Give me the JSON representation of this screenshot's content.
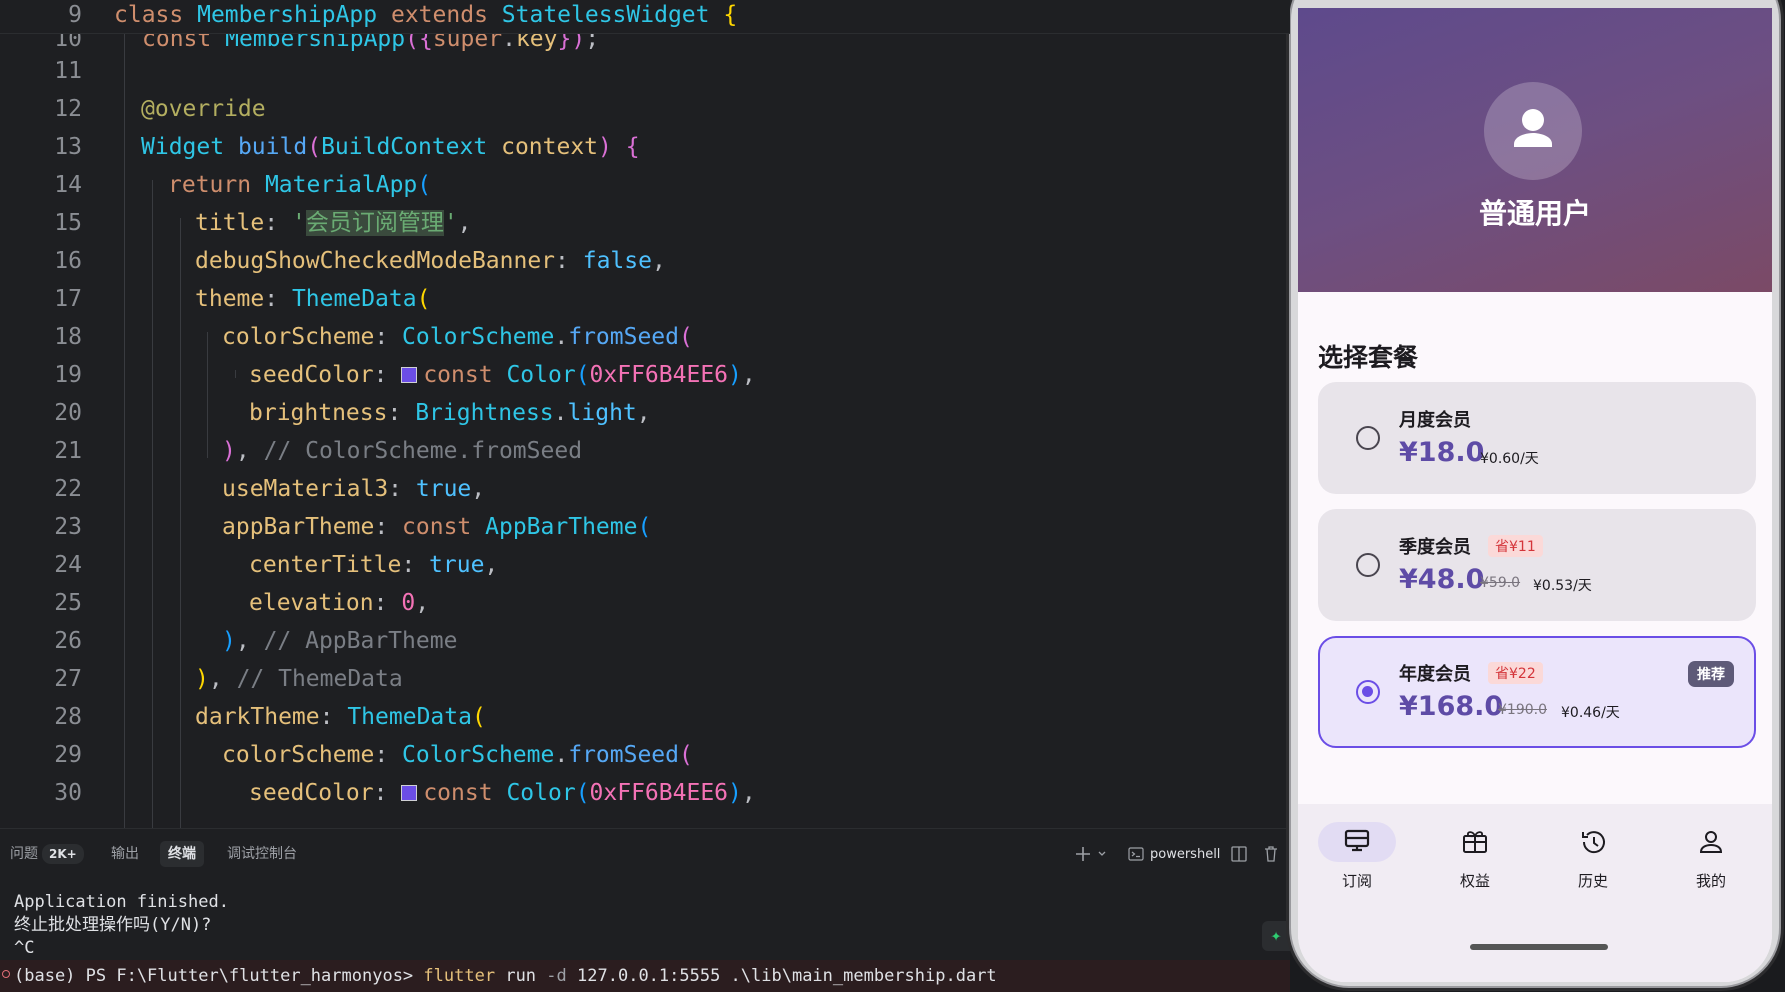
{
  "editor": {
    "sticky": {
      "line": "9",
      "text": "class MembershipApp extends StatelessWidget {"
    },
    "lines": [
      {
        "n": "10",
        "text": "const MembershipApp({super.key});"
      },
      {
        "n": "11",
        "text": ""
      },
      {
        "n": "12",
        "text": "@override"
      },
      {
        "n": "13",
        "text": "Widget build(BuildContext context) {"
      },
      {
        "n": "14",
        "text": "return MaterialApp("
      },
      {
        "n": "15",
        "text": "title: '会员订阅管理',"
      },
      {
        "n": "16",
        "text": "debugShowCheckedModeBanner: false,"
      },
      {
        "n": "17",
        "text": "theme: ThemeData("
      },
      {
        "n": "18",
        "text": "colorScheme: ColorScheme.fromSeed("
      },
      {
        "n": "19",
        "text": "seedColor: const Color(0xFF6B4EE6),"
      },
      {
        "n": "20",
        "text": "brightness: Brightness.light,"
      },
      {
        "n": "21",
        "text": "), // ColorScheme.fromSeed"
      },
      {
        "n": "22",
        "text": "useMaterial3: true,"
      },
      {
        "n": "23",
        "text": "appBarTheme: const AppBarTheme("
      },
      {
        "n": "24",
        "text": "centerTitle: true,"
      },
      {
        "n": "25",
        "text": "elevation: 0,"
      },
      {
        "n": "26",
        "text": "), // AppBarTheme"
      },
      {
        "n": "27",
        "text": "), // ThemeData"
      },
      {
        "n": "28",
        "text": "darkTheme: ThemeData("
      },
      {
        "n": "29",
        "text": "colorScheme: ColorScheme.fromSeed("
      },
      {
        "n": "30",
        "text": "seedColor: const Color(0xFF6B4EE6),"
      }
    ],
    "swatch_color": "#6B4EE6"
  },
  "panel": {
    "tabs": [
      {
        "label": "问题",
        "badge": "2K+"
      },
      {
        "label": "输出"
      },
      {
        "label": "终端"
      },
      {
        "label": "调试控制台"
      }
    ],
    "active_tab": "终端",
    "shell_label": "powershell",
    "terminal_lines": [
      "Application finished.",
      "终止批处理操作吗(Y/N)?",
      "^C"
    ],
    "command": {
      "prompt": "(base) PS F:\\Flutter\\flutter_harmonyos>",
      "program": "flutter",
      "args1": "run",
      "flag": "-d",
      "args2": "127.0.0.1:5555 .\\lib\\main_membership.dart"
    }
  },
  "app": {
    "username": "普通用户",
    "section_title": "选择套餐",
    "plans": [
      {
        "name": "月度会员",
        "price": "¥18.0",
        "per_day": "¥0.60/天",
        "selected": false
      },
      {
        "name": "季度会员",
        "save": "省¥11",
        "price": "¥48.0",
        "original": "¥59.0",
        "per_day": "¥0.53/天",
        "selected": false
      },
      {
        "name": "年度会员",
        "save": "省¥22",
        "price": "¥168.0",
        "original": "¥190.0",
        "per_day": "¥0.46/天",
        "badge": "推荐",
        "selected": true
      }
    ],
    "nav": [
      {
        "label": "订阅",
        "icon": "subscription-icon",
        "active": true
      },
      {
        "label": "权益",
        "icon": "gift-icon",
        "active": false
      },
      {
        "label": "历史",
        "icon": "history-icon",
        "active": false
      },
      {
        "label": "我的",
        "icon": "person-icon",
        "active": false
      }
    ],
    "accent": "#6B4EE6"
  }
}
